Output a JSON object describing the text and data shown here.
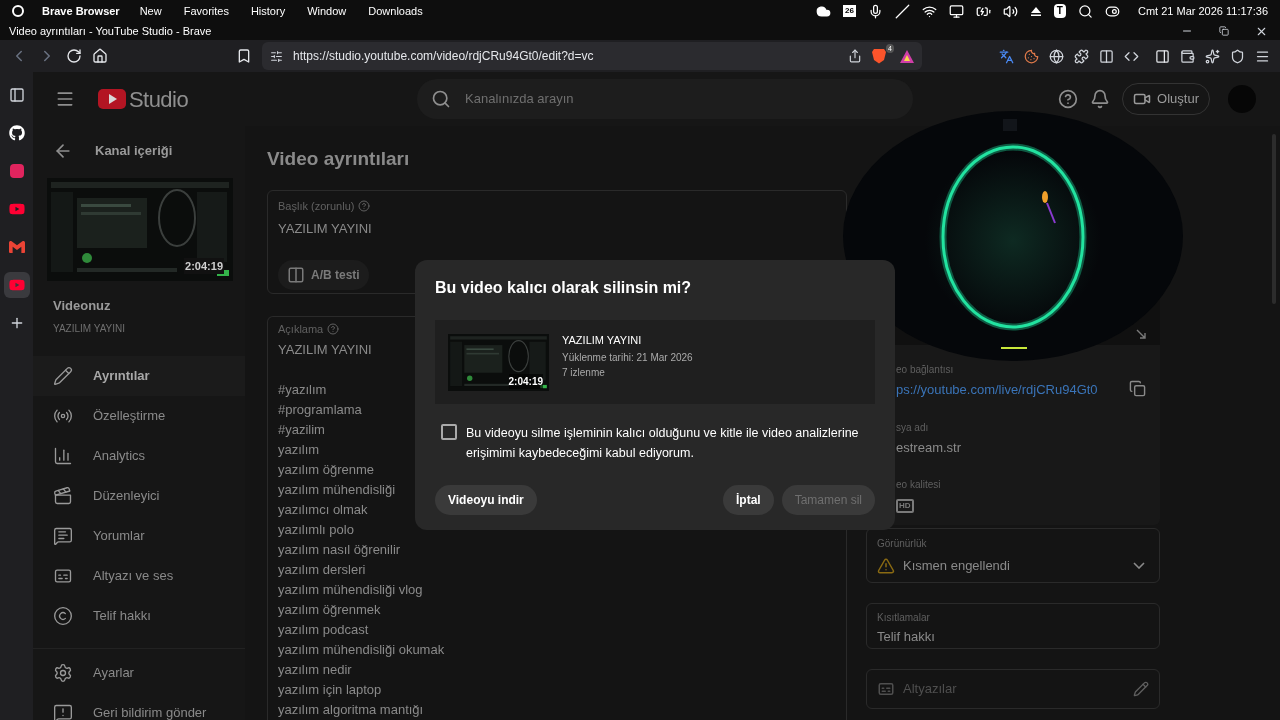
{
  "menubar": {
    "app": "Brave Browser",
    "items": [
      "New",
      "Favorites",
      "History",
      "Window",
      "Downloads"
    ],
    "calendar_day": "26",
    "keyboard_badge": "T",
    "clock": "Cmt 21 Mar 2026 11:17:36"
  },
  "window": {
    "title": "Video ayrıntıları - YouTube Studio - Brave"
  },
  "address_bar": {
    "url": "https://studio.youtube.com/video/rdjCRu94Gt0/edit?d=vc",
    "shield_count": "4"
  },
  "vertical_tabs": [
    {
      "kind": "panel",
      "selected": false
    },
    {
      "kind": "github",
      "selected": false
    },
    {
      "kind": "tapp",
      "selected": false
    },
    {
      "kind": "youtube",
      "selected": false
    },
    {
      "kind": "gmail",
      "selected": false
    },
    {
      "kind": "youtube",
      "selected": true
    },
    {
      "kind": "add",
      "selected": false
    }
  ],
  "header": {
    "logo": "Studio",
    "search_placeholder": "Kanalınızda arayın",
    "create_button": "Oluştur"
  },
  "sidebar": {
    "back": "Kanal içeriği",
    "duration": "2:04:19",
    "video_label": "Videonuz",
    "video_title": "YAZILIM YAYINI",
    "items": [
      {
        "kind": "pencil",
        "label": "Ayrıntılar",
        "selected": true
      },
      {
        "kind": "radio",
        "label": "Özelleştirme",
        "selected": false
      },
      {
        "kind": "chart",
        "label": "Analytics",
        "selected": false
      },
      {
        "kind": "clapper",
        "label": "Düzenleyici",
        "selected": false
      },
      {
        "kind": "comment",
        "label": "Yorumlar",
        "selected": false
      },
      {
        "kind": "captions",
        "label": "Altyazı ve ses",
        "selected": false
      },
      {
        "kind": "copyright",
        "label": "Telif hakkı",
        "selected": false
      }
    ],
    "footer_items": [
      {
        "kind": "settings",
        "label": "Ayarlar"
      },
      {
        "kind": "feedback",
        "label": "Geri bildirim gönder"
      }
    ]
  },
  "page": {
    "title": "Video ayrıntıları",
    "title_field": {
      "label": "Başlık (zorunlu)",
      "value": "YAZILIM YAYINI"
    },
    "ab_button": "A/B testi",
    "description": {
      "label": "Açıklama",
      "value": "YAZILIM YAYINI",
      "lines": [
        "#yazılım",
        "#programlama",
        "#yazilim",
        "yazılım",
        "yazılım öğrenme",
        "yazılım mühendisliği",
        "yazılımcı olmak",
        "yazılımlı polo",
        "yazılım nasıl öğrenilir",
        "yazılım dersleri",
        "yazılım mühendisliği vlog",
        "yazılım öğrenmek",
        "yazılım podcast",
        "yazılım mühendisliği okumak",
        "yazılım nedir",
        "yazılım için laptop",
        "yazılım algoritma mantığı"
      ]
    }
  },
  "right_panel": {
    "link_label": "eo bağlantısı",
    "link": "ps://youtube.com/live/rdjCRu94Gt0",
    "file_label": "sya adı",
    "file_name": "estream.str",
    "quality_label": "eo kalitesi",
    "quality_badge": "HD",
    "visibility": {
      "label": "Görünürlük",
      "value": "Kısmen engellendi"
    },
    "restrictions": {
      "label": "Kısıtlamalar",
      "value": "Telif hakkı"
    },
    "subtitles": {
      "placeholder": "Altyazılar"
    }
  },
  "dialog": {
    "title": "Bu video kalıcı olarak silinsin mi?",
    "video": {
      "title": "YAZILIM YAYINI",
      "uploaded": "Yüklenme tarihi: 21 Mar 2026",
      "views": "7 izlenme",
      "duration": "2:04:19"
    },
    "checkbox": {
      "label": "Bu videoyu silme işleminin kalıcı olduğunu ve kitle ile video analizlerine erişimimi kaybedeceğimi kabul ediyorum.",
      "checked": false
    },
    "buttons": [
      {
        "label": "Videoyu indir",
        "disabled": false
      },
      {
        "label": "İptal",
        "disabled": false
      },
      {
        "label": "Tamamen sil",
        "disabled": true
      }
    ]
  }
}
